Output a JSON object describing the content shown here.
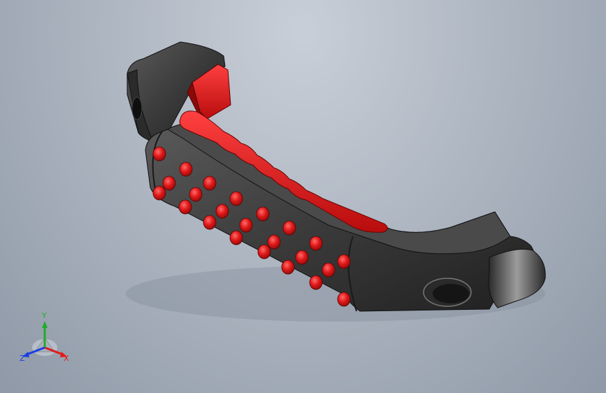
{
  "viewport": {
    "background_top": "#c9cfd8",
    "background_bottom": "#8f99a7"
  },
  "model": {
    "body_color": "#3b3b3b",
    "grip_color": "#d41414",
    "grip_highlight": "#ff5a5a"
  },
  "triad": {
    "x_label": "X",
    "y_label": "Y",
    "z_label": "Z",
    "x_color": "#e11b1b",
    "y_color": "#1fae2a",
    "z_color": "#1b3fe1"
  }
}
